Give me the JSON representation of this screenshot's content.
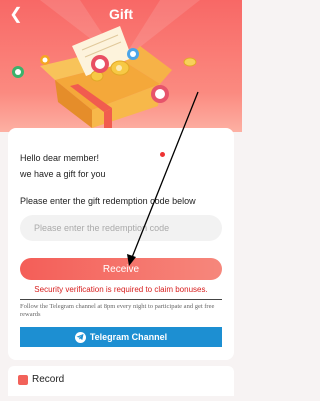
{
  "header": {
    "title": "Gift",
    "back_icon": "chevron-left-icon",
    "bg_top": "#f86866",
    "bg_bottom": "#fdb0a3"
  },
  "gift": {
    "greeting_line1": "Hello dear member!",
    "greeting_line2": "we have a gift for you",
    "prompt": "Please enter the gift redemption code below",
    "input_value": "",
    "input_placeholder": "Please enter the redemption code",
    "receive_label": "Receive",
    "security_text": "Security verification is required to claim bonuses.",
    "telegram_note": "Follow the Telegram channel at 8pm every night to participate and get free rewards",
    "telegram_button": "Telegram Channel",
    "accent": "#f45e58",
    "telegram_color": "#1d8fd2",
    "security_color": "#d71d1d"
  },
  "record": {
    "label": "Record",
    "icon": "record-icon"
  }
}
